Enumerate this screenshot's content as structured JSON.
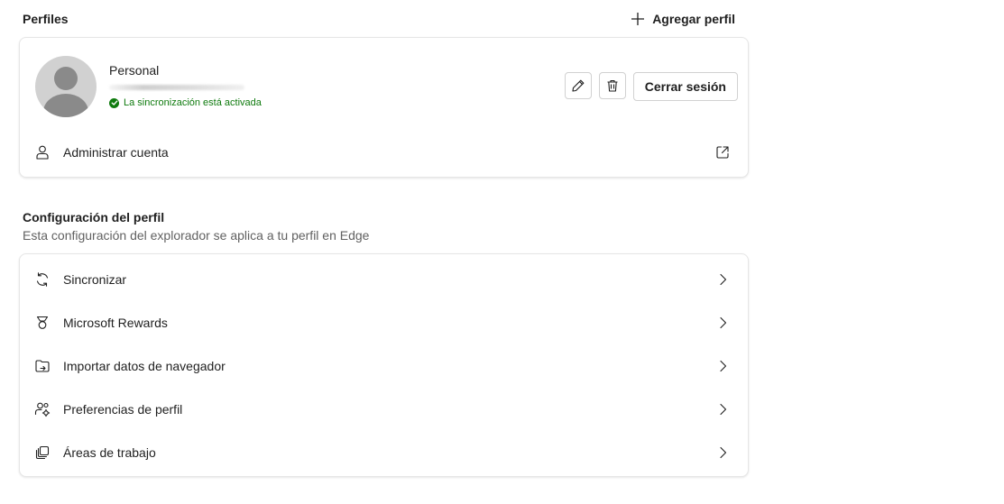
{
  "profiles_section": {
    "title": "Perfiles",
    "add_profile_label": "Agregar perfil"
  },
  "profile": {
    "name": "Personal",
    "sync_status": "La sincronización está activada",
    "sign_out_label": "Cerrar sesión",
    "manage_account_label": "Administrar cuenta"
  },
  "settings_section": {
    "title": "Configuración del perfil",
    "description": "Esta configuración del explorador se aplica a tu perfil en Edge",
    "items": [
      {
        "label": "Sincronizar",
        "icon": "sync-icon"
      },
      {
        "label": "Microsoft Rewards",
        "icon": "rewards-icon"
      },
      {
        "label": "Importar datos de navegador",
        "icon": "import-icon"
      },
      {
        "label": "Preferencias de perfil",
        "icon": "profile-preferences-icon"
      },
      {
        "label": "Áreas de trabajo",
        "icon": "workspaces-icon"
      }
    ]
  },
  "colors": {
    "sync_green": "#0e7a0d",
    "border": "#e6e6e6",
    "text": "#1f1f1f",
    "secondary_text": "#616161"
  }
}
